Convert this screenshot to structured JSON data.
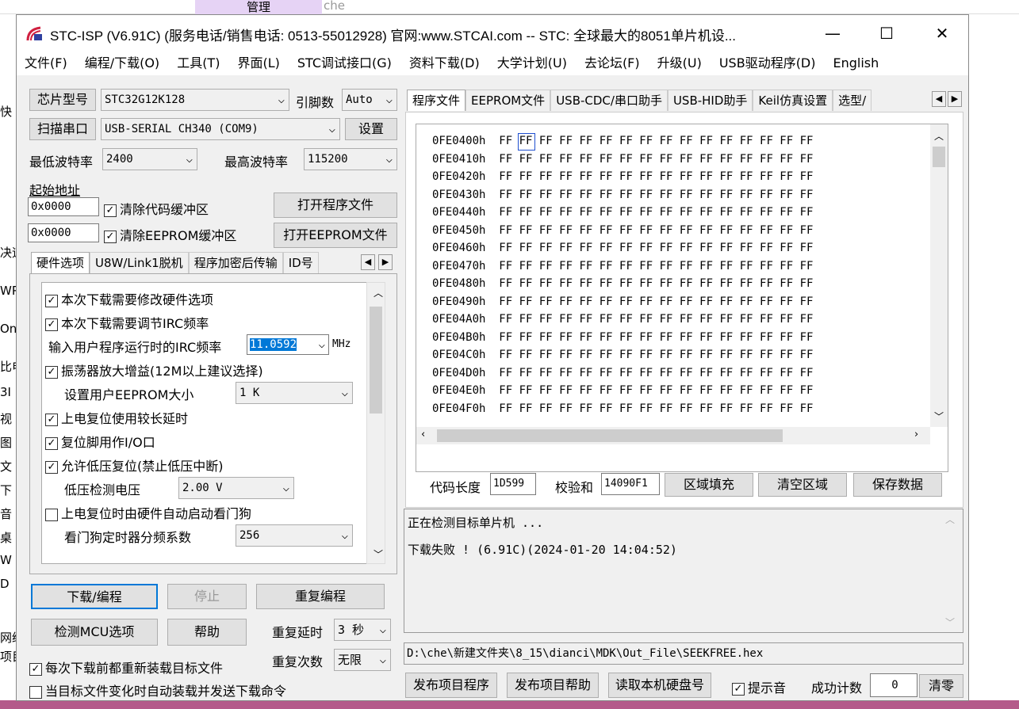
{
  "background": {
    "explorer_tab": "管理",
    "folder": "che",
    "left_fragments": [
      "快",
      "决速",
      "WP",
      "On",
      "比电",
      "3I",
      "视",
      "图",
      "文",
      "下",
      "音",
      "桌",
      "W",
      "D",
      "网络",
      "项目"
    ]
  },
  "window": {
    "title": "STC-ISP (V6.91C) (服务电话/销售电话: 0513-55012928) 官网:www.STCAI.com  -- STC: 全球最大的8051单片机设...",
    "minimize": "—",
    "maximize": "☐",
    "close": "✕"
  },
  "menu": [
    "文件(F)",
    "编程/下载(O)",
    "工具(T)",
    "界面(L)",
    "STC调试接口(G)",
    "资料下载(D)",
    "大学计划(U)",
    "去论坛(F)",
    "升级(U)",
    "USB驱动程序(D)",
    "English"
  ],
  "left": {
    "chip_label": "芯片型号",
    "chip_value": "STC32G12K128",
    "pins_label": "引脚数",
    "pins_value": "Auto",
    "scan_label": "扫描串口",
    "port_value": "USB-SERIAL CH340 (COM9)",
    "settings": "设置",
    "min_baud_label": "最低波特率",
    "min_baud": "2400",
    "max_baud_label": "最高波特率",
    "max_baud": "115200",
    "start_addr_label": "起始地址",
    "addr1": "0x0000",
    "clear_code": "清除代码缓冲区",
    "open_prog": "打开程序文件",
    "addr2": "0x0000",
    "clear_eeprom": "清除EEPROM缓冲区",
    "open_eeprom": "打开EEPROM文件",
    "tabs": [
      "硬件选项",
      "U8W/Link1脱机",
      "程序加密后传输",
      "ID号"
    ],
    "options": [
      {
        "type": "check",
        "label": "本次下载需要修改硬件选项",
        "checked": true
      },
      {
        "type": "check",
        "label": "本次下载需要调节IRC频率",
        "checked": true
      },
      {
        "type": "input",
        "label": "输入用户程序运行时的IRC频率",
        "value": "11.0592",
        "unit": "MHz"
      },
      {
        "type": "check",
        "label": "振荡器放大增益(12M以上建议选择)",
        "checked": true
      },
      {
        "type": "select",
        "label": "设置用户EEPROM大小",
        "value": "1   K"
      },
      {
        "type": "check",
        "label": "上电复位使用较长延时",
        "checked": true
      },
      {
        "type": "check",
        "label": "复位脚用作I/O口",
        "checked": true
      },
      {
        "type": "check",
        "label": "允许低压复位(禁止低压中断)",
        "checked": true
      },
      {
        "type": "select",
        "label": "低压检测电压",
        "value": "2.00 V"
      },
      {
        "type": "check",
        "label": "上电复位时由硬件自动启动看门狗",
        "checked": false
      },
      {
        "type": "select",
        "label": "看门狗定时器分频系数",
        "value": "256"
      }
    ],
    "download": "下载/编程",
    "stop": "停止",
    "reprogram": "重复编程",
    "detect": "检测MCU选项",
    "help": "帮助",
    "delay_label": "重复延时",
    "delay_value": "3 秒",
    "count_label": "重复次数",
    "count_value": "无限",
    "reload": "每次下载前都重新装载目标文件",
    "auto_reload": "当目标文件变化时自动装载并发送下载命令"
  },
  "right": {
    "tabs": [
      "程序文件",
      "EEPROM文件",
      "USB-CDC/串口助手",
      "USB-HID助手",
      "Keil仿真设置",
      "选型/"
    ],
    "rows": [
      {
        "addr": "0FE0400h",
        "bytes": "FF FF FF FF FF FF FF FF FF FF FF FF FF FF FF FF"
      },
      {
        "addr": "0FE0410h",
        "bytes": "FF FF FF FF FF FF FF FF FF FF FF FF FF FF FF FF"
      },
      {
        "addr": "0FE0420h",
        "bytes": "FF FF FF FF FF FF FF FF FF FF FF FF FF FF FF FF"
      },
      {
        "addr": "0FE0430h",
        "bytes": "FF FF FF FF FF FF FF FF FF FF FF FF FF FF FF FF"
      },
      {
        "addr": "0FE0440h",
        "bytes": "FF FF FF FF FF FF FF FF FF FF FF FF FF FF FF FF"
      },
      {
        "addr": "0FE0450h",
        "bytes": "FF FF FF FF FF FF FF FF FF FF FF FF FF FF FF FF"
      },
      {
        "addr": "0FE0460h",
        "bytes": "FF FF FF FF FF FF FF FF FF FF FF FF FF FF FF FF"
      },
      {
        "addr": "0FE0470h",
        "bytes": "FF FF FF FF FF FF FF FF FF FF FF FF FF FF FF FF"
      },
      {
        "addr": "0FE0480h",
        "bytes": "FF FF FF FF FF FF FF FF FF FF FF FF FF FF FF FF"
      },
      {
        "addr": "0FE0490h",
        "bytes": "FF FF FF FF FF FF FF FF FF FF FF FF FF FF FF FF"
      },
      {
        "addr": "0FE04A0h",
        "bytes": "FF FF FF FF FF FF FF FF FF FF FF FF FF FF FF FF"
      },
      {
        "addr": "0FE04B0h",
        "bytes": "FF FF FF FF FF FF FF FF FF FF FF FF FF FF FF FF"
      },
      {
        "addr": "0FE04C0h",
        "bytes": "FF FF FF FF FF FF FF FF FF FF FF FF FF FF FF FF"
      },
      {
        "addr": "0FE04D0h",
        "bytes": "FF FF FF FF FF FF FF FF FF FF FF FF FF FF FF FF"
      },
      {
        "addr": "0FE04E0h",
        "bytes": "FF FF FF FF FF FF FF FF FF FF FF FF FF FF FF FF"
      },
      {
        "addr": "0FE04F0h",
        "bytes": "FF FF FF FF FF FF FF FF FF FF FF FF FF FF FF FF"
      }
    ],
    "code_len_label": "代码长度",
    "code_len": "1D599",
    "checksum_label": "校验和",
    "checksum": "14090F1",
    "fill": "区域填充",
    "clear": "清空区域",
    "save": "保存数据",
    "log": [
      "正在检测目标单片机 ...",
      "下载失败 ! (6.91C)(2024-01-20 14:04:52)"
    ],
    "path": "D:\\che\\新建文件夹\\8_15\\dianci\\MDK\\Out_File\\SEEKFREE.hex",
    "publish_prog": "发布项目程序",
    "publish_help": "发布项目帮助",
    "read_disk": "读取本机硬盘号",
    "sound": "提示音",
    "success_label": "成功计数",
    "success_count": "0",
    "reset": "清零"
  }
}
